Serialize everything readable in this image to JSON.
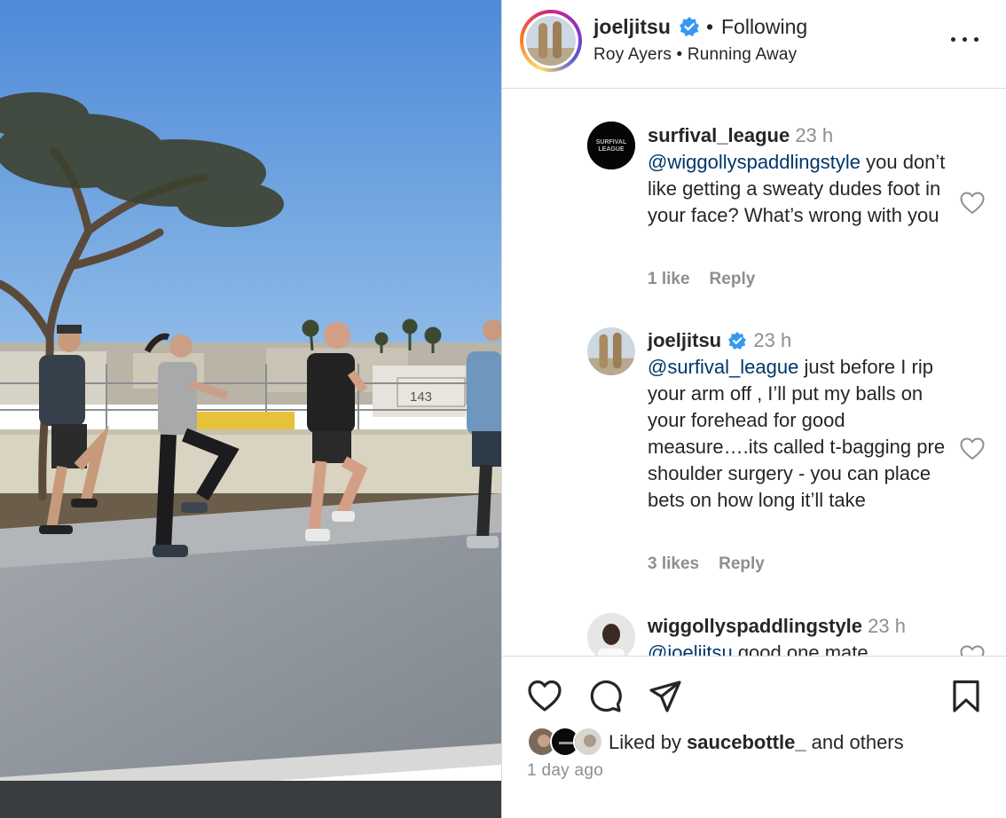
{
  "header": {
    "username": "joeljitsu",
    "separator": "•",
    "follow_status": "Following",
    "audio": "Roy Ayers • Running Away"
  },
  "comments": [
    {
      "username": "surfival_league",
      "time": "23 h",
      "mention": "@wiggollyspaddlingstyle",
      "text": " you don’t like getting a sweaty dudes foot in your face? What’s wrong with you",
      "likes": "1 like",
      "reply": "Reply",
      "avatar_text": "SURFIVAL LEAGUE"
    },
    {
      "username": "joeljitsu",
      "time": "23 h",
      "mention": "@surfival_league",
      "text": " just before I rip your arm off , I’ll put my balls on your forehead for good measure….its called t-bagging pre shoulder surgery - you can place bets on how long it’ll take",
      "likes": "3 likes",
      "reply": "Reply"
    },
    {
      "username": "wiggollyspaddlingstyle",
      "time": "23 h",
      "mention": "@joeljitsu",
      "text": " good one mate"
    }
  ],
  "footer": {
    "liked_prefix": "Liked by ",
    "liked_user": "saucebottle_",
    "liked_suffix": " and others",
    "age": "1 day ago"
  },
  "media": {
    "sign_number": "143"
  },
  "colors": {
    "verified": "#3897f0",
    "mention": "#00376b",
    "secondary_text": "#8e8e8e",
    "divider": "#dbdbdb",
    "sky": "#6fa3dd"
  },
  "icons": [
    "verified-badge-icon",
    "more-options-icon",
    "heart-icon",
    "comment-icon",
    "share-icon",
    "bookmark-icon"
  ]
}
